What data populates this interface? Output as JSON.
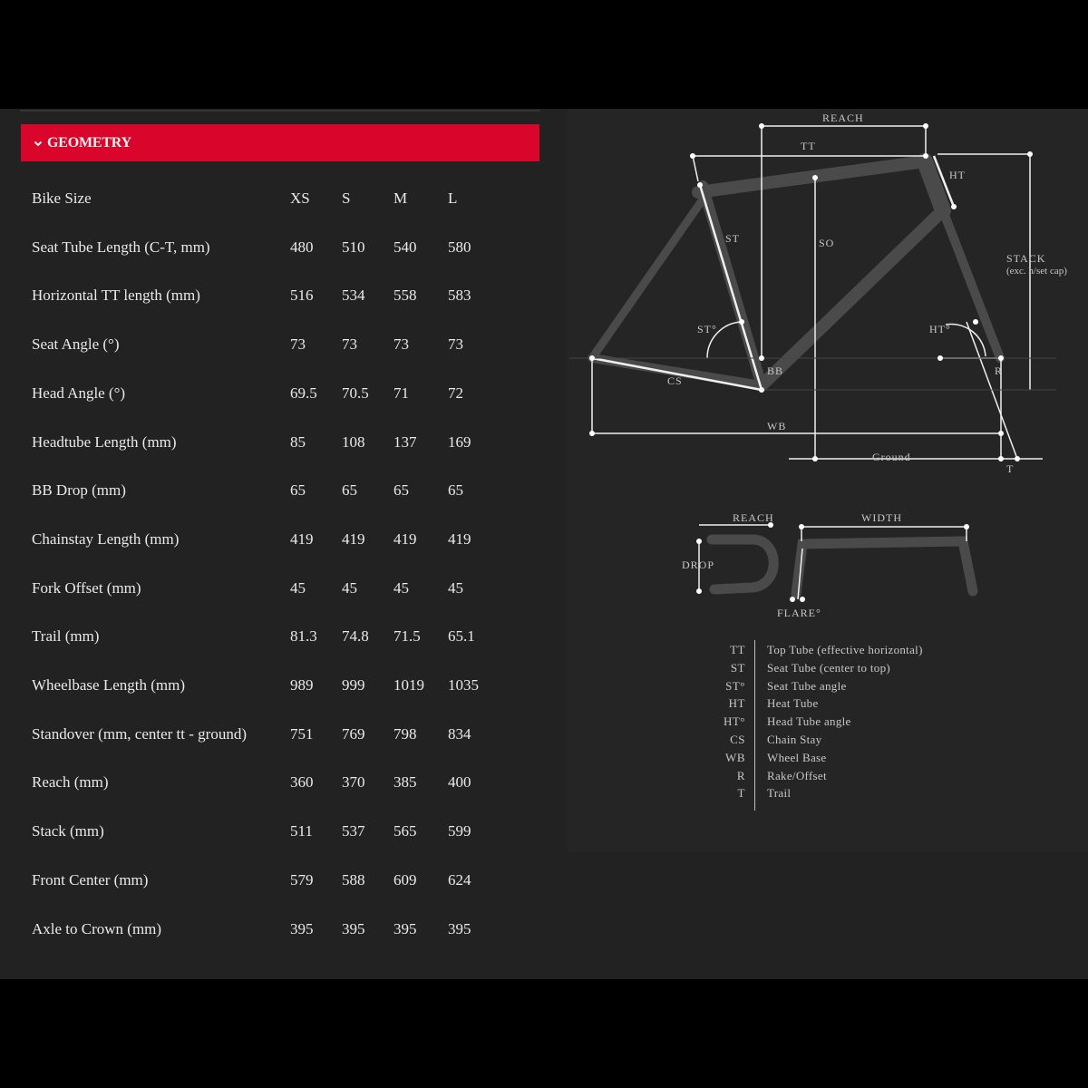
{
  "header": {
    "title": "GEOMETRY"
  },
  "table": {
    "rows": [
      {
        "label": "Bike Size",
        "values": [
          "XS",
          "S",
          "M",
          "L"
        ]
      },
      {
        "label": "Seat Tube Length (C-T, mm)",
        "values": [
          "480",
          "510",
          "540",
          "580"
        ]
      },
      {
        "label": "Horizontal TT length (mm)",
        "values": [
          "516",
          "534",
          "558",
          "583"
        ]
      },
      {
        "label": "Seat Angle (°)",
        "values": [
          "73",
          "73",
          "73",
          "73"
        ]
      },
      {
        "label": "Head Angle (°)",
        "values": [
          "69.5",
          "70.5",
          "71",
          "72"
        ]
      },
      {
        "label": "Headtube Length (mm)",
        "values": [
          "85",
          "108",
          "137",
          "169"
        ]
      },
      {
        "label": "BB Drop (mm)",
        "values": [
          "65",
          "65",
          "65",
          "65"
        ]
      },
      {
        "label": "Chainstay Length (mm)",
        "values": [
          "419",
          "419",
          "419",
          "419"
        ]
      },
      {
        "label": "Fork Offset (mm)",
        "values": [
          "45",
          "45",
          "45",
          "45"
        ]
      },
      {
        "label": "Trail (mm)",
        "values": [
          "81.3",
          "74.8",
          "71.5",
          "65.1"
        ]
      },
      {
        "label": "Wheelbase Length (mm)",
        "values": [
          "989",
          "999",
          "1019",
          "1035"
        ]
      },
      {
        "label": "Standover (mm, center tt - ground)",
        "values": [
          "751",
          "769",
          "798",
          "834"
        ]
      },
      {
        "label": "Reach (mm)",
        "values": [
          "360",
          "370",
          "385",
          "400"
        ]
      },
      {
        "label": "Stack (mm)",
        "values": [
          "511",
          "537",
          "565",
          "599"
        ]
      },
      {
        "label": "Front Center (mm)",
        "values": [
          "579",
          "588",
          "609",
          "624"
        ]
      },
      {
        "label": "Axle to Crown (mm)",
        "values": [
          "395",
          "395",
          "395",
          "395"
        ]
      }
    ]
  },
  "diagram": {
    "labels": {
      "reach": "REACH",
      "tt": "TT",
      "ht": "HT",
      "st": "ST",
      "so": "SO",
      "stack": "STACK",
      "stack_note": "(exc. h/set cap)",
      "st_angle": "ST°",
      "ht_angle": "HT°",
      "bb": "BB",
      "cs": "CS",
      "r": "R",
      "wb": "WB",
      "ground": "Ground",
      "t": "T"
    },
    "bar_labels": {
      "reach": "REACH",
      "width": "WIDTH",
      "drop": "DROP",
      "flare": "FLARE°"
    }
  },
  "legend": [
    {
      "abbr": "TT",
      "desc": "Top Tube (effective horizontal)"
    },
    {
      "abbr": "ST",
      "desc": "Seat Tube (center to top)"
    },
    {
      "abbr": "ST°",
      "desc": "Seat Tube angle"
    },
    {
      "abbr": "HT",
      "desc": "Heat Tube"
    },
    {
      "abbr": "HT°",
      "desc": "Head Tube angle"
    },
    {
      "abbr": "CS",
      "desc": "Chain Stay"
    },
    {
      "abbr": "WB",
      "desc": "Wheel Base"
    },
    {
      "abbr": "R",
      "desc": "Rake/Offset"
    },
    {
      "abbr": "T",
      "desc": "Trail"
    }
  ]
}
